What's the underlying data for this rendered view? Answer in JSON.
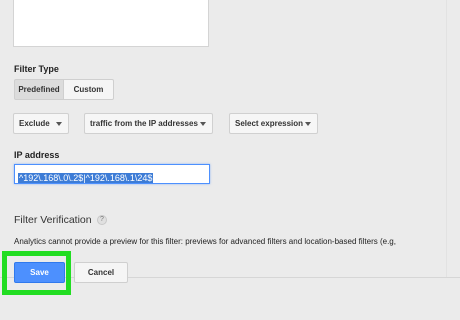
{
  "filter_type": {
    "label": "Filter Type",
    "options": [
      {
        "label": "Predefined",
        "selected": true
      },
      {
        "label": "Custom",
        "selected": false
      }
    ]
  },
  "predefined": {
    "action": "Exclude",
    "source": "traffic from the IP addresses",
    "expression": "Select expression"
  },
  "ip_address": {
    "label": "IP address",
    "value": "^192\\.168\\.0\\.2$|^192\\.168\\.1\\24$"
  },
  "verification": {
    "title": "Filter Verification",
    "help_icon": "question-mark",
    "message": "Analytics cannot provide a preview for this filter: previews for advanced filters and location-based filters (e.g,"
  },
  "actions": {
    "save_label": "Save",
    "cancel_label": "Cancel"
  },
  "colors": {
    "primary_button": "#4d90fe",
    "highlight": "#22dd22",
    "selection": "#3d7cd6"
  }
}
